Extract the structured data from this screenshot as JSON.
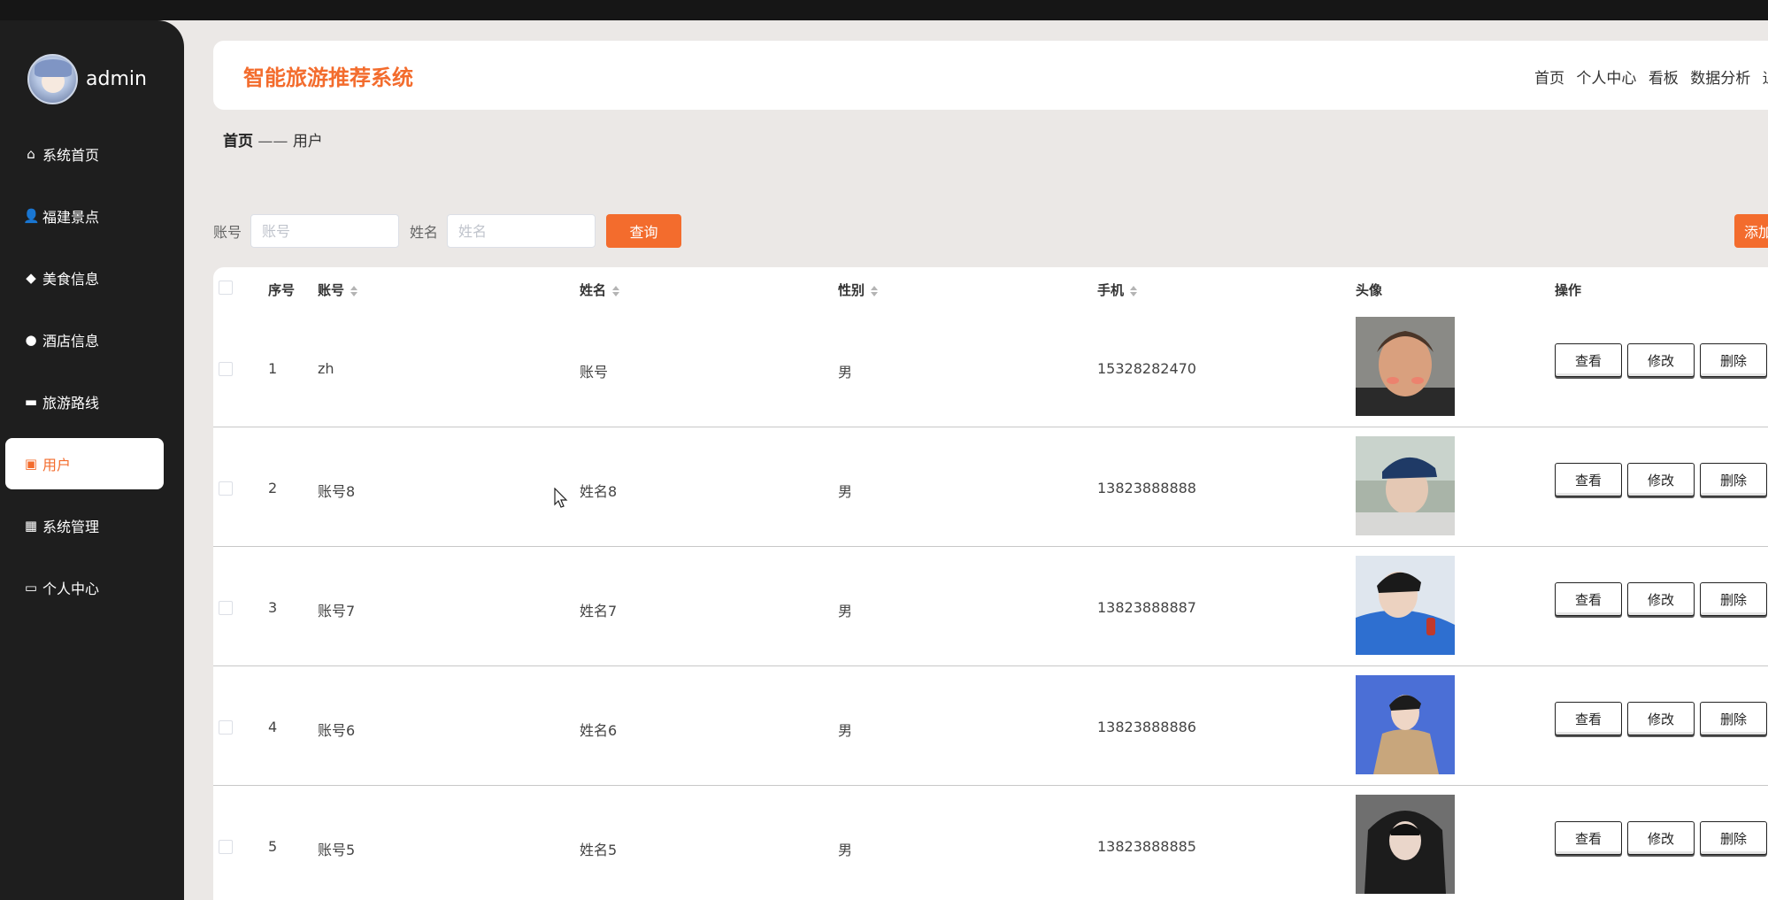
{
  "app": {
    "title": "智能旅游推荐系统"
  },
  "user": {
    "name": "admin"
  },
  "sidebar": {
    "items": [
      {
        "label": "系统首页",
        "icon": "home-icon",
        "glyph": "⌂"
      },
      {
        "label": "福建景点",
        "icon": "person-icon",
        "glyph": "👤"
      },
      {
        "label": "美食信息",
        "icon": "food-icon",
        "glyph": "◆"
      },
      {
        "label": "酒店信息",
        "icon": "location-icon",
        "glyph": "●"
      },
      {
        "label": "旅游路线",
        "icon": "ticket-icon",
        "glyph": "▬"
      },
      {
        "label": "用户",
        "icon": "chart-icon",
        "glyph": "▣"
      },
      {
        "label": "系统管理",
        "icon": "grid-icon",
        "glyph": "▦"
      },
      {
        "label": "个人中心",
        "icon": "calendar-icon",
        "glyph": "▭"
      }
    ]
  },
  "topnav": {
    "items": [
      "首页",
      "个人中心",
      "看板",
      "数据分析",
      "退"
    ]
  },
  "breadcrumb": {
    "home": "首页",
    "separator": "——",
    "current": "用户"
  },
  "search": {
    "account_label": "账号",
    "account_placeholder": "账号",
    "name_label": "姓名",
    "name_placeholder": "姓名",
    "query_label": "查询",
    "add_label": "添加"
  },
  "table": {
    "headers": {
      "index": "序号",
      "account": "账号",
      "name": "姓名",
      "gender": "性别",
      "phone": "手机",
      "avatar": "头像",
      "ops": "操作"
    },
    "actions": {
      "view": "查看",
      "edit": "修改",
      "delete": "删除"
    },
    "rows": [
      {
        "index": "1",
        "account": "zh",
        "name": "账号",
        "gender": "男",
        "phone": "15328282470"
      },
      {
        "index": "2",
        "account": "账号8",
        "name": "姓名8",
        "gender": "男",
        "phone": "13823888888"
      },
      {
        "index": "3",
        "account": "账号7",
        "name": "姓名7",
        "gender": "男",
        "phone": "13823888887"
      },
      {
        "index": "4",
        "account": "账号6",
        "name": "姓名6",
        "gender": "男",
        "phone": "13823888886"
      },
      {
        "index": "5",
        "account": "账号5",
        "name": "姓名5",
        "gender": "男",
        "phone": "13823888885"
      }
    ]
  },
  "colors": {
    "accent": "#f36c2d",
    "sidebar": "#1e1e1e",
    "background": "#ebe8e6"
  }
}
